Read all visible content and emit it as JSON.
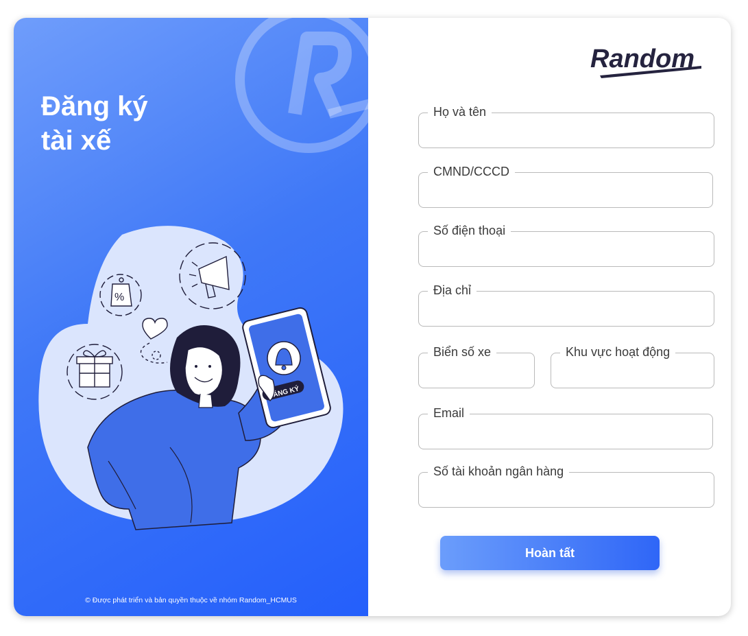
{
  "left_panel": {
    "title_line1": "Đăng ký",
    "title_line2": "tài xế",
    "phone_badge": "ĐĂNG KÝ",
    "copyright": "© Được phát triển và bản quyền thuộc về nhóm Random_HCMUS"
  },
  "brand": {
    "logo_text": "Random"
  },
  "form": {
    "fields": [
      {
        "label": "Họ và tên",
        "value": ""
      },
      {
        "label": "CMND/CCCD",
        "value": ""
      },
      {
        "label": "Số điện thoại",
        "value": ""
      },
      {
        "label": "Địa chỉ",
        "value": ""
      },
      {
        "label": "Biển số xe",
        "value": ""
      },
      {
        "label": "Khu vực hoạt động",
        "value": ""
      },
      {
        "label": "Email",
        "value": ""
      },
      {
        "label": "Số tài khoản ngân hàng",
        "value": ""
      }
    ],
    "submit_label": "Hoàn tất"
  },
  "colors": {
    "primary": "#2f66f7",
    "primary_light": "#6f9dfb",
    "text_dark": "#1f1d3a",
    "border": "#b9b9b9"
  },
  "icons": [
    "registered-r-icon",
    "tag-percent-icon",
    "megaphone-icon",
    "gift-icon",
    "heart-icon",
    "bell-icon"
  ]
}
